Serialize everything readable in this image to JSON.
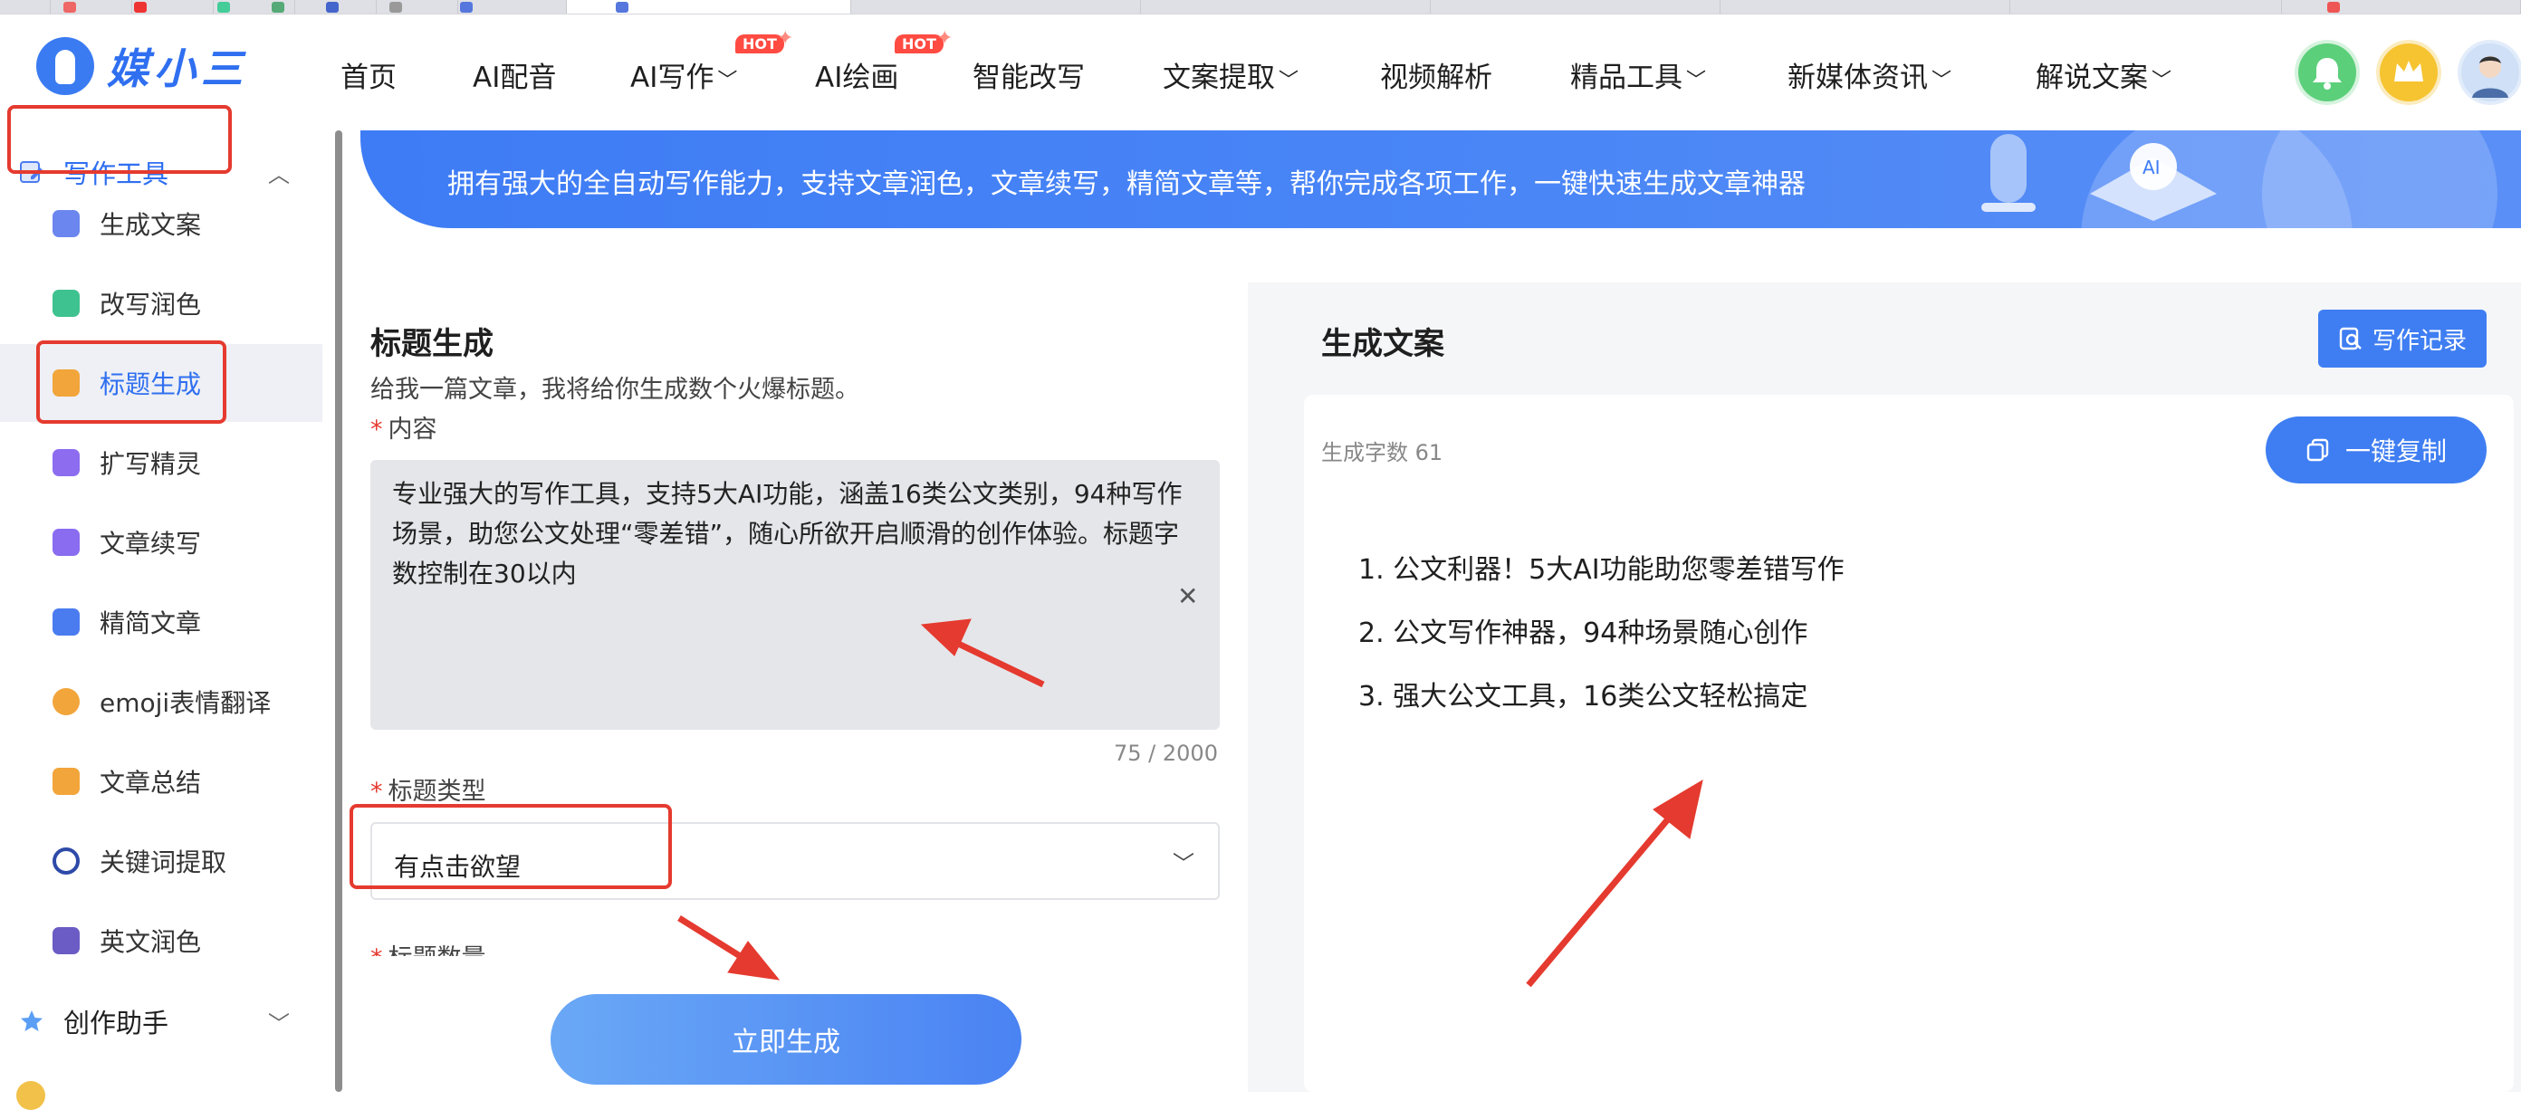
{
  "nav": {
    "logo_text": "媒小三",
    "items": [
      {
        "label": "首页"
      },
      {
        "label": "AI配音"
      },
      {
        "label": "AI写作",
        "chevron": true,
        "badge": "HOT"
      },
      {
        "label": "AI绘画",
        "badge": "HOT"
      },
      {
        "label": "智能改写"
      },
      {
        "label": "文案提取",
        "chevron": true
      },
      {
        "label": "视频解析"
      },
      {
        "label": "精品工具",
        "chevron": true
      },
      {
        "label": "新媒体资讯",
        "chevron": true
      },
      {
        "label": "解说文案",
        "chevron": true
      }
    ],
    "chevron_glyph": "﹀",
    "icons": [
      "bell-icon",
      "crown-icon",
      "avatar"
    ]
  },
  "sidebar": {
    "group_writing": "写作工具",
    "items": [
      {
        "label": "生成文案",
        "icon": "generate-icon",
        "color": "#6b86ee"
      },
      {
        "label": "改写润色",
        "icon": "rewrite-icon",
        "color": "#3ec28f"
      },
      {
        "label": "标题生成",
        "icon": "title-icon",
        "color": "#f2a53a"
      },
      {
        "label": "扩写精灵",
        "icon": "expand-icon",
        "color": "#8d6cf0"
      },
      {
        "label": "文章续写",
        "icon": "continue-icon",
        "color": "#8a6cf0"
      },
      {
        "label": "精简文章",
        "icon": "simplify-icon",
        "color": "#4a7cf0"
      },
      {
        "label": "emoji表情翻译",
        "icon": "emoji-icon",
        "color": "#f2a53a"
      },
      {
        "label": "文章总结",
        "icon": "summary-icon",
        "color": "#f2a53a"
      },
      {
        "label": "关键词提取",
        "icon": "target-icon",
        "color": "#2e4aa8"
      },
      {
        "label": "英文润色",
        "icon": "english-icon",
        "color": "#6a5cc4"
      }
    ],
    "group_assistant": "创作助手"
  },
  "banner": {
    "text": "拥有强大的全自动写作能力，支持文章润色，文章续写，精简文章等，帮你完成各项工作，一键快速生成文章神器"
  },
  "form": {
    "title": "标题生成",
    "subtitle": "给我一篇文章，我将给你生成数个火爆标题。",
    "content_label": "内容",
    "content_value": "专业强大的写作工具，支持5大AI功能，涵盖16类公文类别，94种写作场景，助您公文处理“零差错”，随心所欲开启顺滑的创作体验。标题字数控制在30以内",
    "counter": "75 / 2000",
    "type_label": "标题类型",
    "type_value": "有点击欲望",
    "count_label": "标题数量",
    "generate_button": "立即生成"
  },
  "result": {
    "title": "生成文案",
    "record_button": "写作记录",
    "word_count": "生成字数 61",
    "copy_button": "一键复制",
    "lines": [
      "1. 公文利器！5大AI功能助您零差错写作",
      "2. 公文写作神器，94种场景随心创作",
      "3. 强大公文工具，16类公文轻松搞定"
    ]
  },
  "colors": {
    "brand": "#3f7ef2",
    "annotation": "#e53a2f",
    "hot": "#ff4b42"
  }
}
